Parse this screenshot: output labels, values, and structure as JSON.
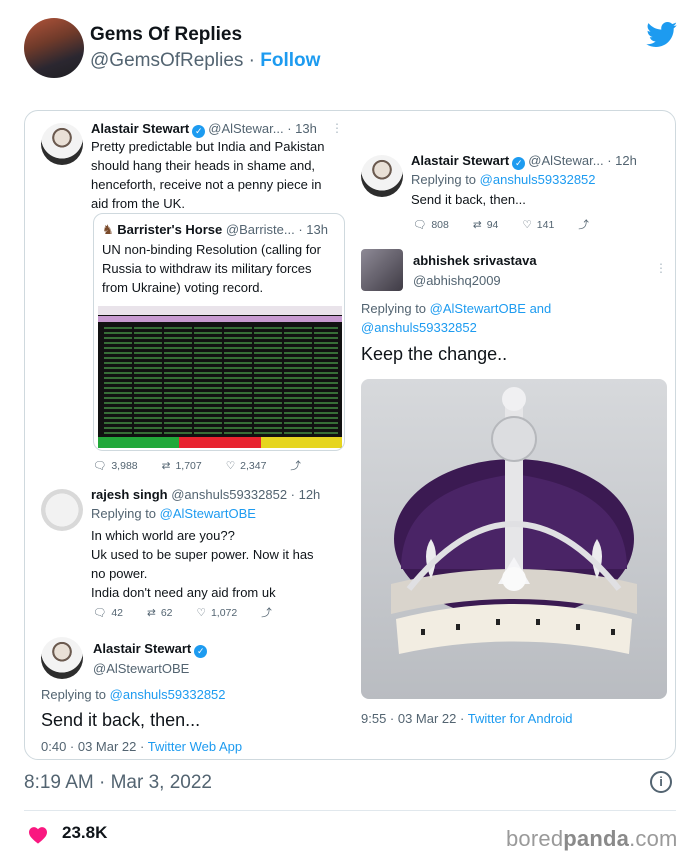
{
  "outer": {
    "name": "Gems Of Replies",
    "handle": "@GemsOfReplies",
    "separator": "·",
    "follow": "Follow",
    "time": "8:19 AM · Mar 3, 2022",
    "likes": "23.8K",
    "watermark_light": "bored",
    "watermark_bold": "panda",
    "watermark_tld": ".com"
  },
  "left": {
    "main": {
      "name": "Alastair Stewart",
      "meta": "@AlStewar... · 13h",
      "text": [
        "Pretty predictable but India and Pakistan",
        "should hang their heads in shame and,",
        "henceforth, receive not a penny piece in",
        "aid from the UK."
      ]
    },
    "quote": {
      "name": "Barrister's Horse",
      "meta": "@Barriste... · 13h",
      "text": [
        "UN non-binding Resolution (calling for",
        "Russia to withdraw its military forces",
        "from Ukraine) voting record."
      ]
    },
    "main_actions": {
      "replies": "3,988",
      "retweets": "1,707",
      "likes": "2,347"
    },
    "reply": {
      "name": "rajesh singh",
      "meta": "@anshuls59332852 · 12h",
      "replying_to_label": "Replying to",
      "replying_to": "@AlStewartOBE",
      "text": [
        "In which world are you??",
        "Uk used to be super power. Now it has",
        "no power.",
        "India don't need any aid from uk"
      ]
    },
    "reply_actions": {
      "replies": "42",
      "retweets": "62",
      "likes": "1,072"
    },
    "final": {
      "name": "Alastair Stewart",
      "handle": "@AlStewartOBE",
      "replying_to_label": "Replying to",
      "replying_to": "@anshuls59332852",
      "text": "Send it back, then...",
      "time": "0:40 · 03 Mar 22 ·",
      "source": "Twitter Web App"
    }
  },
  "right": {
    "top": {
      "name": "Alastair Stewart",
      "meta": "@AlStewar... · 12h",
      "replying_to_label": "Replying to",
      "replying_to": "@anshuls59332852",
      "text": "Send it back, then...",
      "actions": {
        "replies": "808",
        "retweets": "94",
        "likes": "141"
      }
    },
    "reply": {
      "name": "abhishek srivastava",
      "handle": "@abhishq2009",
      "replying_to_label": "Replying to",
      "replying_to_a": "@AlStewartOBE",
      "and": "and",
      "replying_to_b": "@anshuls59332852",
      "text": "Keep the change..",
      "time": "9:55 · 03 Mar 22 ·",
      "source": "Twitter for Android"
    }
  },
  "colors": {
    "twitter_blue": "#1d9bf0",
    "heart": "#f91880",
    "crown_velvet": "#3b1a52"
  }
}
